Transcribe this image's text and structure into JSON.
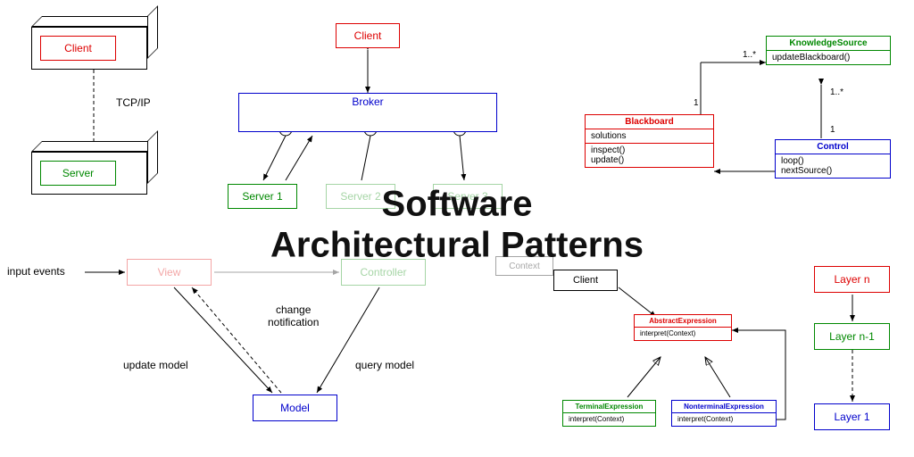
{
  "title_line1": "Software",
  "title_line2": "Architectural Patterns",
  "client_server": {
    "client": "Client",
    "server": "Server",
    "protocol": "TCP/IP"
  },
  "broker": {
    "client": "Client",
    "broker": "Broker",
    "servers": [
      "Server 1",
      "Server 2",
      "Server 3"
    ]
  },
  "mvc": {
    "input": "input events",
    "view": "View",
    "controller": "Controller",
    "model": "Model",
    "change_notification": "change\nnotification",
    "update_model": "update model",
    "query_model": "query model"
  },
  "blackboard": {
    "blackboard": {
      "name": "Blackboard",
      "attrs": "solutions",
      "ops": "inspect()\nupdate()"
    },
    "knowledge": {
      "name": "KnowledgeSource",
      "ops": "updateBlackboard()"
    },
    "control": {
      "name": "Control",
      "ops": "loop()\nnextSource()"
    },
    "mult_one": "1",
    "mult_many": "1..*"
  },
  "interpreter": {
    "client": "Client",
    "context": "Context",
    "abstract": {
      "name": "AbstractExpression",
      "ops": "interpret(Context)"
    },
    "terminal": {
      "name": "TerminalExpression",
      "ops": "interpret(Context)"
    },
    "nonterminal": {
      "name": "NonterminalExpression",
      "ops": "interpret(Context)"
    }
  },
  "layered": {
    "layer_n": "Layer n",
    "layer_n1": "Layer n-1",
    "layer_1": "Layer 1"
  }
}
